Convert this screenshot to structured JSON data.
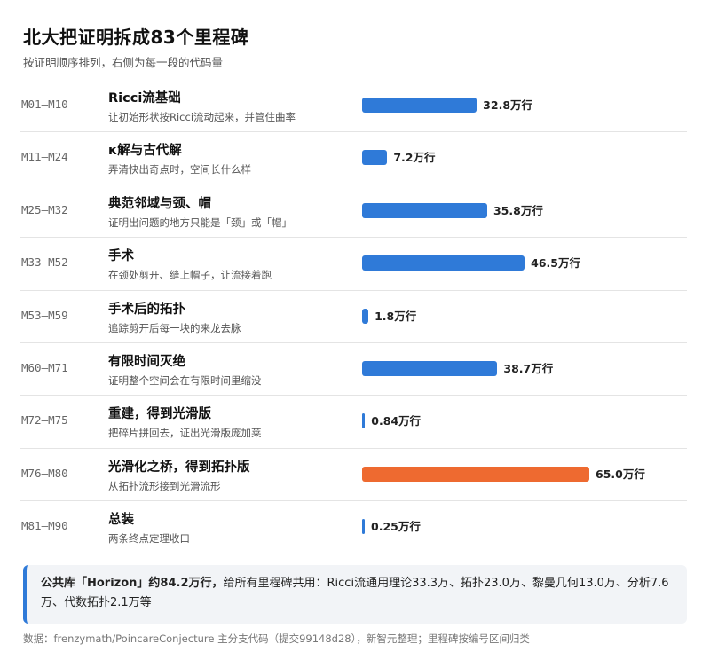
{
  "title": "北大把证明拆成83个里程碑",
  "subtitle": "按证明顺序排列，右侧为每一段的代码量",
  "colors": {
    "normal": "#2f7ad8",
    "highlight": "#ee6a30"
  },
  "chart_data": {
    "type": "bar",
    "orientation": "horizontal",
    "unit": "万行",
    "categories": [
      "M01–M10",
      "M11–M24",
      "M25–M32",
      "M33–M52",
      "M53–M59",
      "M60–M71",
      "M72–M75",
      "M76–M80",
      "M81–M90"
    ],
    "names": [
      "Ricci流基础",
      "κ解与古代解",
      "典范邻域与颈、帽",
      "手术",
      "手术后的拓扑",
      "有限时间灭绝",
      "重建，得到光滑版",
      "光滑化之桥，得到拓扑版",
      "总装"
    ],
    "descriptions": [
      "让初始形状按Ricci流动起来，并管住曲率",
      "弄清快出奇点时，空间长什么样",
      "证明出问题的地方只能是「颈」或「帽」",
      "在颈处剪开、缝上帽子，让流接着跑",
      "追踪剪开后每一块的来龙去脉",
      "证明整个空间会在有限时间里缩没",
      "把碎片拼回去，证出光滑版庞加莱",
      "从拓扑流形接到光滑流形",
      "两条终点定理收口"
    ],
    "values": [
      32.8,
      7.2,
      35.8,
      46.5,
      1.8,
      38.7,
      0.84,
      65.0,
      0.25
    ],
    "value_labels": [
      "32.8万行",
      "7.2万行",
      "35.8万行",
      "46.5万行",
      "1.8万行",
      "38.7万行",
      "0.84万行",
      "65.0万行",
      "0.25万行"
    ],
    "highlight_index": 7,
    "xlim": [
      0,
      65.0
    ]
  },
  "note": {
    "bold": "公共库「Horizon」约84.2万行，",
    "text": "给所有里程碑共用：Ricci流通用理论33.3万、拓扑23.0万、黎曼几何13.0万、分析7.6万、代数拓扑2.1万等"
  },
  "source": "数据：frenzymath/PoincareConjecture 主分支代码（提交99148d28），新智元整理；里程碑按编号区间归类"
}
